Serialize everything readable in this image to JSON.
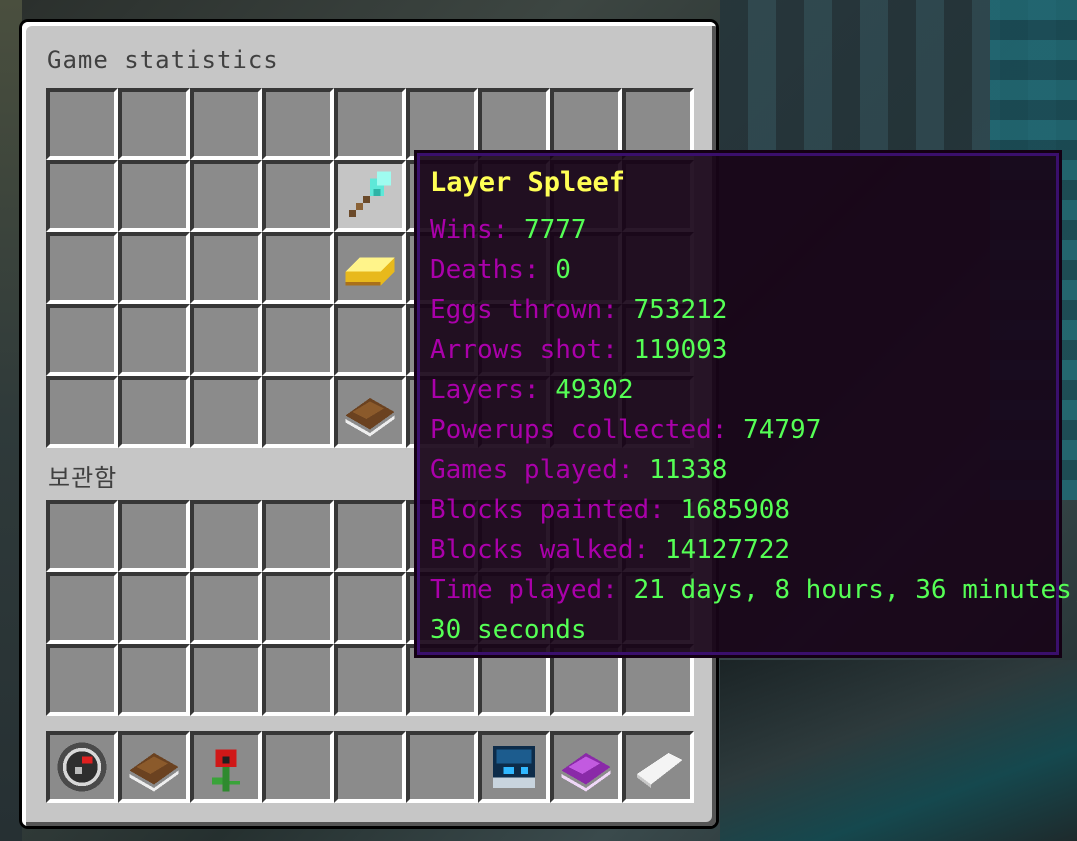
{
  "window": {
    "title": "Game statistics",
    "storage_label": "보관함"
  },
  "tooltip": {
    "title": "Layer Spleef",
    "stats": [
      {
        "key": "Wins:",
        "value": "7777"
      },
      {
        "key": "Deaths:",
        "value": "0"
      },
      {
        "key": "Eggs thrown:",
        "value": "753212"
      },
      {
        "key": "Arrows shot:",
        "value": "119093"
      },
      {
        "key": "Layers:",
        "value": "49302"
      },
      {
        "key": "Powerups collected:",
        "value": "74797"
      },
      {
        "key": "Games played:",
        "value": "11338"
      },
      {
        "key": "Blocks painted:",
        "value": "1685908"
      },
      {
        "key": "Blocks walked:",
        "value": "14127722"
      },
      {
        "key": "Time played:",
        "value": "21 days, 8 hours, 36 minutes,"
      },
      {
        "key": "",
        "value": "30 seconds"
      }
    ]
  },
  "icons": {
    "slot_shovel": "diamond-shovel-icon",
    "slot_gold": "gold-ingot-icon",
    "slot_book": "book-icon",
    "hotbar_1": "compass-icon",
    "hotbar_2": "book-icon",
    "hotbar_3": "poppy-icon",
    "hotbar_7": "player-head-icon",
    "hotbar_8": "enchanted-book-icon",
    "hotbar_9": "paper-icon"
  },
  "colors": {
    "tooltip_title": "#ffff55",
    "stat_key": "#aa00aa",
    "stat_value": "#55ff55"
  }
}
